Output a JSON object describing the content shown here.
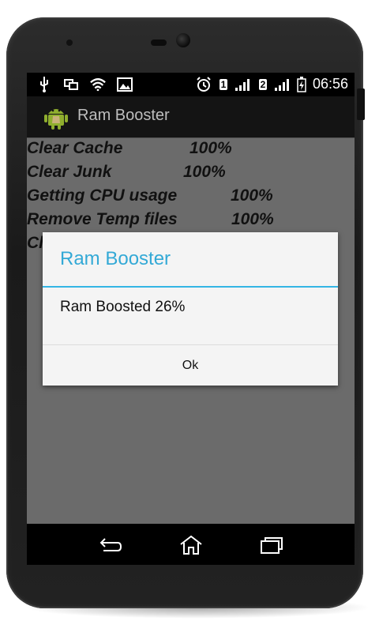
{
  "status_bar": {
    "time": "06:56",
    "icons": [
      "usb-icon",
      "overlay-icon",
      "wifi-icon",
      "image-icon",
      "alarm-icon",
      "sim1-icon",
      "signal-icon",
      "sim2-icon",
      "signal-icon",
      "battery-charging-icon"
    ],
    "sim1_label": "1",
    "sim2_label": "2"
  },
  "action_bar": {
    "title": "Ram Booster",
    "icon": "android-app-icon"
  },
  "tasks": [
    {
      "label": "Clear Cache",
      "percent": "100%"
    },
    {
      "label": "Clear Junk",
      "percent": "100%"
    },
    {
      "label": "Getting CPU usage",
      "percent": "100%"
    },
    {
      "label": "Remove Temp files",
      "percent": "100%"
    },
    {
      "label": "Cl",
      "percent": ""
    }
  ],
  "dialog": {
    "title": "Ram Booster",
    "message": "Ram Boosted 26%",
    "ok_label": "Ok"
  },
  "nav_bar": {
    "icons": [
      "back-icon",
      "home-icon",
      "recent-apps-icon"
    ]
  },
  "colors": {
    "dialog_accent": "#33b5e5",
    "content_bg": "#6b6b6b"
  }
}
